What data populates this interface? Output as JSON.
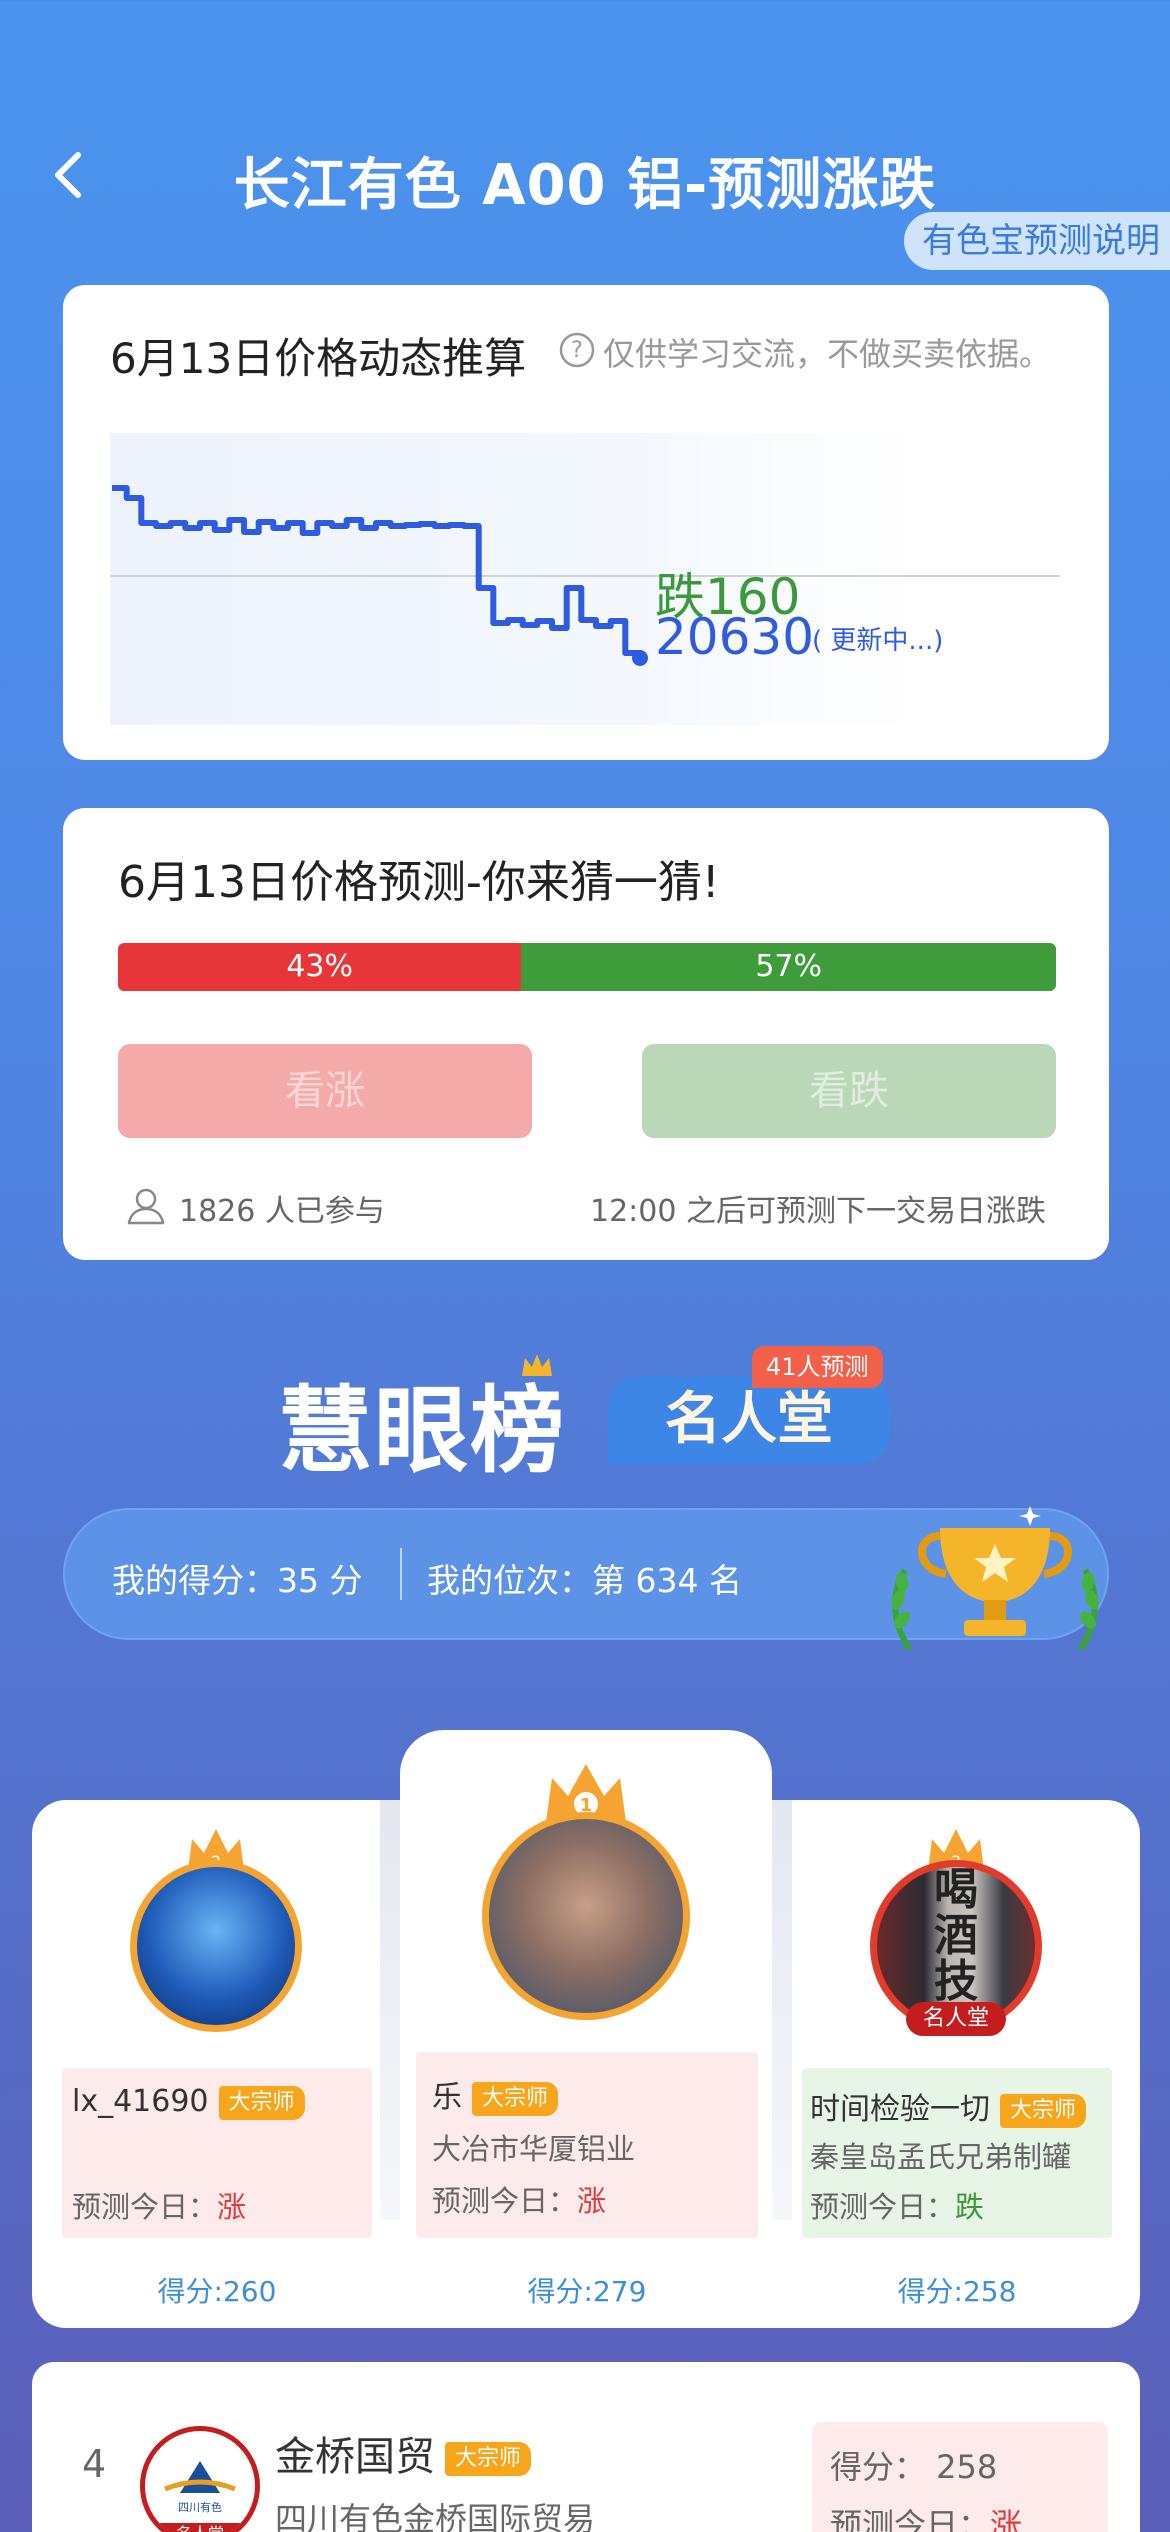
{
  "header": {
    "title": "长江有色 A00 铝-预测涨跌",
    "explain_button": "有色宝预测说明"
  },
  "dynamic_card": {
    "title": "6月13日价格动态推算",
    "note": "仅供学习交流，不做买卖依据。",
    "change_label": "跌160",
    "price": "20630",
    "status": "( 更新中...)",
    "line_color": "#2f5be0"
  },
  "chart_data": {
    "type": "line",
    "series": [
      {
        "values": [
          20800,
          20790,
          20765,
          20762,
          20765,
          20760,
          20765,
          20758,
          20768,
          20756,
          20766,
          20760,
          20765,
          20755,
          20765,
          20762,
          20768,
          20760,
          20765,
          20762,
          20763,
          20764,
          20762,
          20763,
          20762,
          20700,
          20665,
          20668,
          20663,
          20667,
          20660,
          20700,
          20668,
          20662,
          20667,
          20635,
          20630
        ]
      }
    ],
    "baseline": 20790,
    "current": 20630,
    "change": -160,
    "grid": false
  },
  "predict_card": {
    "title": "6月13日价格预测-你来猜一猜!",
    "up_percent": 43,
    "down_percent": 57,
    "up_label": "43%",
    "down_label": "57%",
    "up_button": "看涨",
    "down_button": "看跌",
    "participants": "1826 人已参与",
    "next_note": "12:00 之后可预测下一交易日涨跌",
    "up_color": "#e8353a",
    "down_color": "#3f9c3a"
  },
  "leaderboard": {
    "title": "慧眼榜",
    "hall_tab": "名人堂",
    "hall_badge": "41人预测",
    "my_score": "我的得分：35 分",
    "my_rank": "我的位次：第 634 名"
  },
  "podium": [
    {
      "rank": "2",
      "name": "lx_41690",
      "tag": "大宗师",
      "company": "",
      "pred_label": "预测今日：",
      "pred_value": "涨",
      "score": "得分:260"
    },
    {
      "rank": "1",
      "name": "乐",
      "tag": "大宗师",
      "company": "大冶市华厦铝业",
      "pred_label": "预测今日：",
      "pred_value": "涨",
      "score": "得分:279"
    },
    {
      "rank": "3",
      "name": "时间检验一切",
      "tag": "大宗师",
      "company": "秦皇岛孟氏兄弟制罐",
      "pred_label": "预测今日：",
      "pred_value": "跌",
      "score": "得分:258",
      "avatar_text": "喝酒技",
      "hall_tag": "名人堂"
    }
  ],
  "rank4": {
    "rank": "4",
    "name": "金桥国贸",
    "tag": "大宗师",
    "company": "四川有色金桥国际贸易",
    "score": "得分：  258",
    "pred_label": "预测今日：",
    "pred_value": "涨",
    "avatar_text": "四川有色",
    "hall_tag": "名人堂"
  }
}
